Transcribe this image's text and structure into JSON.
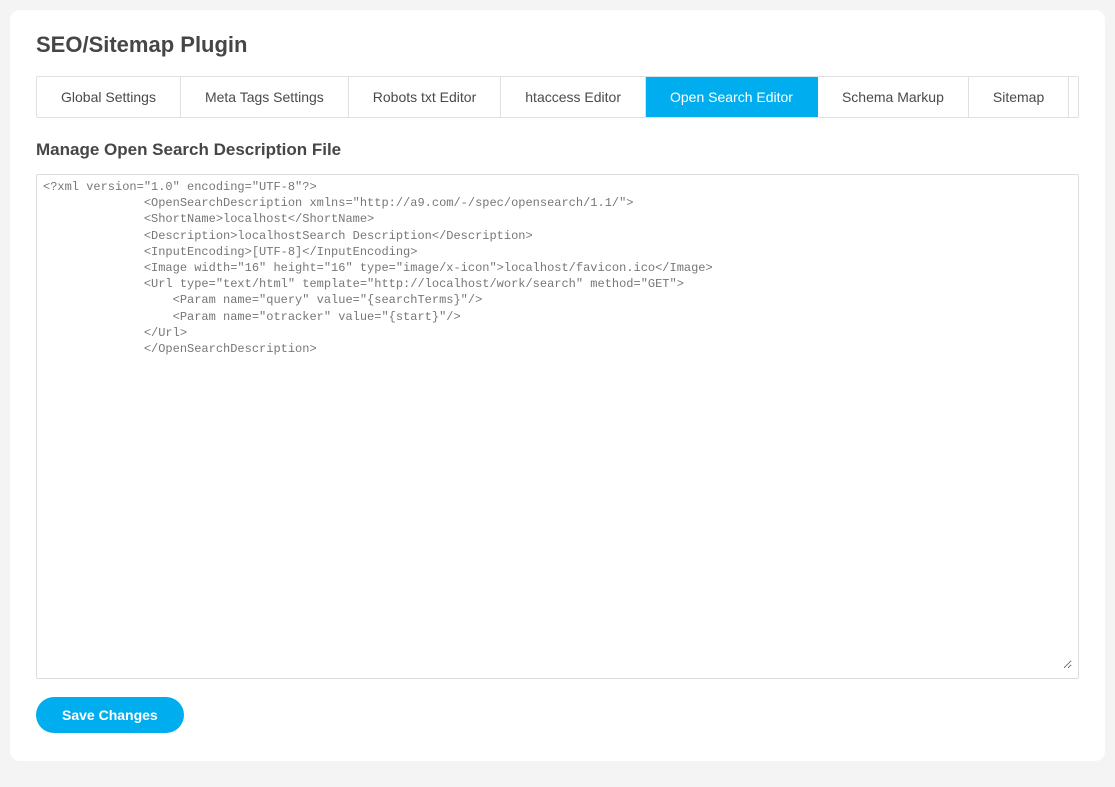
{
  "page_title": "SEO/Sitemap Plugin",
  "tabs": [
    {
      "label": "Global Settings",
      "active": false
    },
    {
      "label": "Meta Tags Settings",
      "active": false
    },
    {
      "label": "Robots txt Editor",
      "active": false
    },
    {
      "label": "htaccess Editor",
      "active": false
    },
    {
      "label": "Open Search Editor",
      "active": true
    },
    {
      "label": "Schema Markup",
      "active": false
    },
    {
      "label": "Sitemap",
      "active": false
    }
  ],
  "section_title": "Manage Open Search Description File",
  "editor_content": "<?xml version=\"1.0\" encoding=\"UTF-8\"?>\n              <OpenSearchDescription xmlns=\"http://a9.com/-/spec/opensearch/1.1/\">\n              <ShortName>localhost</ShortName>\n              <Description>localhostSearch Description</Description>\n              <InputEncoding>[UTF-8]</InputEncoding>\n              <Image width=\"16\" height=\"16\" type=\"image/x-icon\">localhost/favicon.ico</Image>\n              <Url type=\"text/html\" template=\"http://localhost/work/search\" method=\"GET\">\n                  <Param name=\"query\" value=\"{searchTerms}\"/>\n                  <Param name=\"otracker\" value=\"{start}\"/>\n              </Url>\n              </OpenSearchDescription>",
  "save_button_label": "Save Changes"
}
